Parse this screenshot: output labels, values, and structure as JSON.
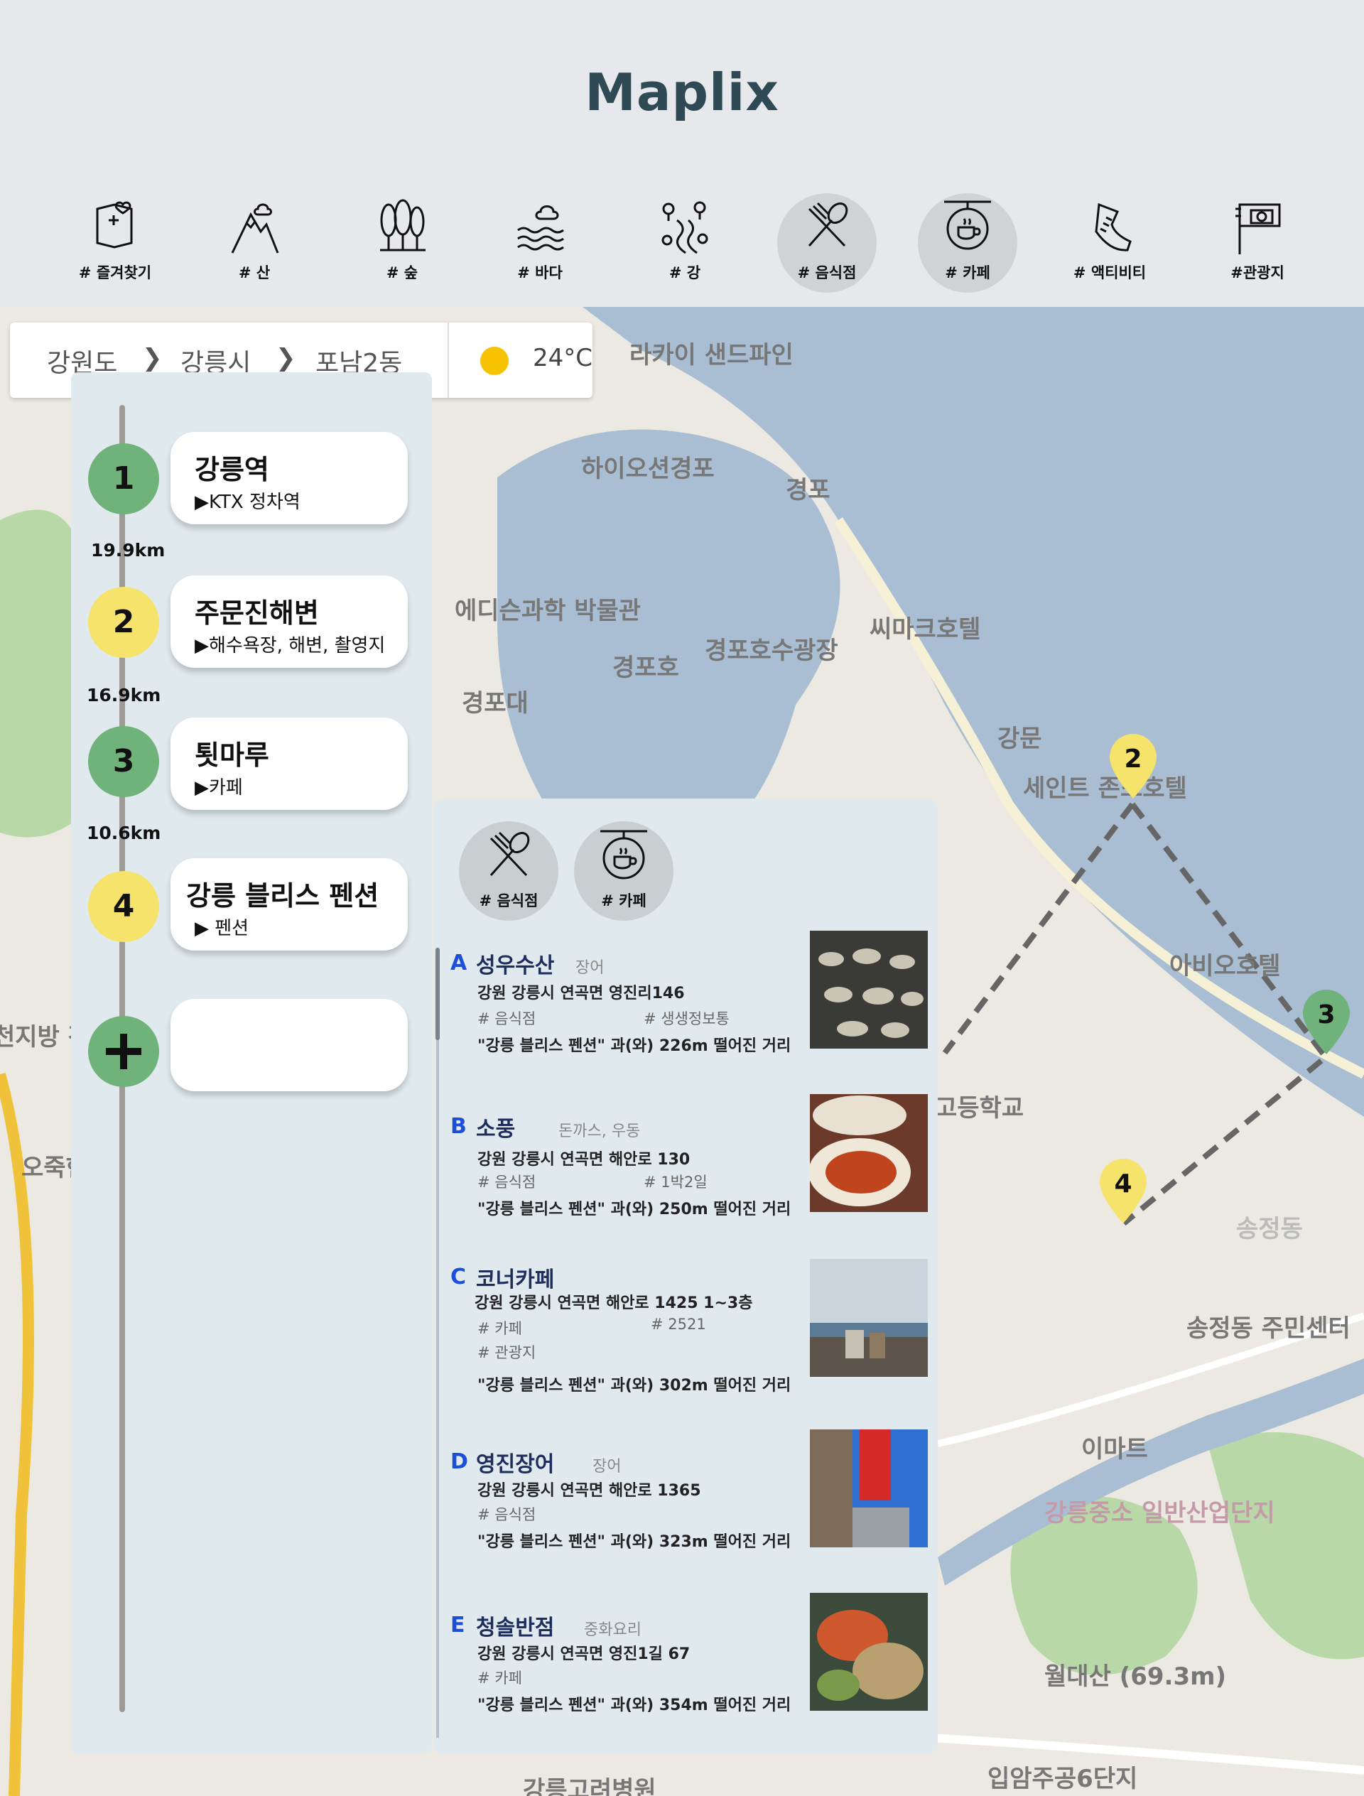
{
  "app": {
    "title": "Maplix"
  },
  "categories": [
    {
      "label": "# 즐겨찾기",
      "icon": "favorite-map-icon",
      "active": false
    },
    {
      "label": "# 산",
      "icon": "mountain-icon",
      "active": false
    },
    {
      "label": "# 숲",
      "icon": "forest-icon",
      "active": false
    },
    {
      "label": "# 바다",
      "icon": "sea-icon",
      "active": false
    },
    {
      "label": "# 강",
      "icon": "river-icon",
      "active": false
    },
    {
      "label": "# 음식점",
      "icon": "fork-spoon-icon",
      "active": true
    },
    {
      "label": "# 카페",
      "icon": "coffee-sign-icon",
      "active": true
    },
    {
      "label": "# 액티비티",
      "icon": "sneaker-icon",
      "active": false
    },
    {
      "label": "#관광지",
      "icon": "camera-sign-icon",
      "active": false
    }
  ],
  "breadcrumb": [
    "강원도",
    "강릉시",
    "포남2동"
  ],
  "weather": {
    "temp": "24°C",
    "icon": "sun-icon"
  },
  "route": {
    "stops": [
      {
        "num": "1",
        "name": "강릉역",
        "desc": "▶KTX 정차역",
        "color": "#6fb27a"
      },
      {
        "num": "2",
        "name": "주문진해변",
        "desc": "▶해수욕장, 해변, 촬영지",
        "color": "#f6e36c"
      },
      {
        "num": "3",
        "name": "툇마루",
        "desc": "▶카페",
        "color": "#6fb27a"
      },
      {
        "num": "4",
        "name": "강릉 블리스 펜션",
        "desc": "▶ 펜션",
        "color": "#f6e36c"
      }
    ],
    "distances": [
      "19.9km",
      "16.9km",
      "10.6km"
    ]
  },
  "filters": [
    {
      "label": "# 음식점",
      "icon": "fork-spoon-icon"
    },
    {
      "label": "# 카페",
      "icon": "coffee-sign-icon"
    }
  ],
  "results": [
    {
      "letter": "A",
      "name": "성우수산",
      "category": "장어",
      "address": "강원 강릉시 연곡면 영진리146",
      "tags": [
        "# 음식점",
        "# 생생정보통"
      ],
      "distance": "\"강릉 블리스 펜션\" 과(와) 226m 떨어진 거리"
    },
    {
      "letter": "B",
      "name": "소풍",
      "category": "돈까스, 우동",
      "address": "강원 강릉시 연곡면 해안로 130",
      "tags": [
        "# 음식점",
        "# 1박2일"
      ],
      "distance": "\"강릉 블리스 펜션\" 과(와) 250m 떨어진 거리"
    },
    {
      "letter": "C",
      "name": "코너카페",
      "category": "",
      "address": "강원 강릉시 연곡면 해안로 1425 1~3층",
      "tags": [
        "# 카페",
        "# 2521",
        "# 관광지"
      ],
      "distance": "\"강릉 블리스 펜션\" 과(와) 302m 떨어진 거리"
    },
    {
      "letter": "D",
      "name": "영진장어",
      "category": "장어",
      "address": "강원 강릉시 연곡면 해안로 1365",
      "tags": [
        "# 음식점"
      ],
      "distance": "\"강릉 블리스 펜션\" 과(와) 323m 떨어진 거리"
    },
    {
      "letter": "E",
      "name": "청솔반점",
      "category": "중화요리",
      "address": "강원 강릉시 연곡면 영진1길 67",
      "tags": [
        "# 카페"
      ],
      "distance": "\"강릉 블리스 펜션\" 과(와) 354m 떨어진 거리"
    }
  ],
  "map_labels": [
    "라카이 샌드파인",
    "하이오션경포",
    "경포",
    "에디슨과학 박물관",
    "경포호",
    "경포호수광장",
    "씨마크호텔",
    "경포대",
    "강문",
    "세인트 존스호텔",
    "아비오호텔",
    "고등학교",
    "송정동",
    "송정동 주민센터",
    "이마트",
    "강릉중소 일반산업단지",
    "월대산 (69.3m)",
    "강릉고려병원",
    "입암주공6단지",
    "천지방 강릉지원",
    "오죽헌"
  ],
  "map_pins": [
    "2",
    "3",
    "4"
  ]
}
